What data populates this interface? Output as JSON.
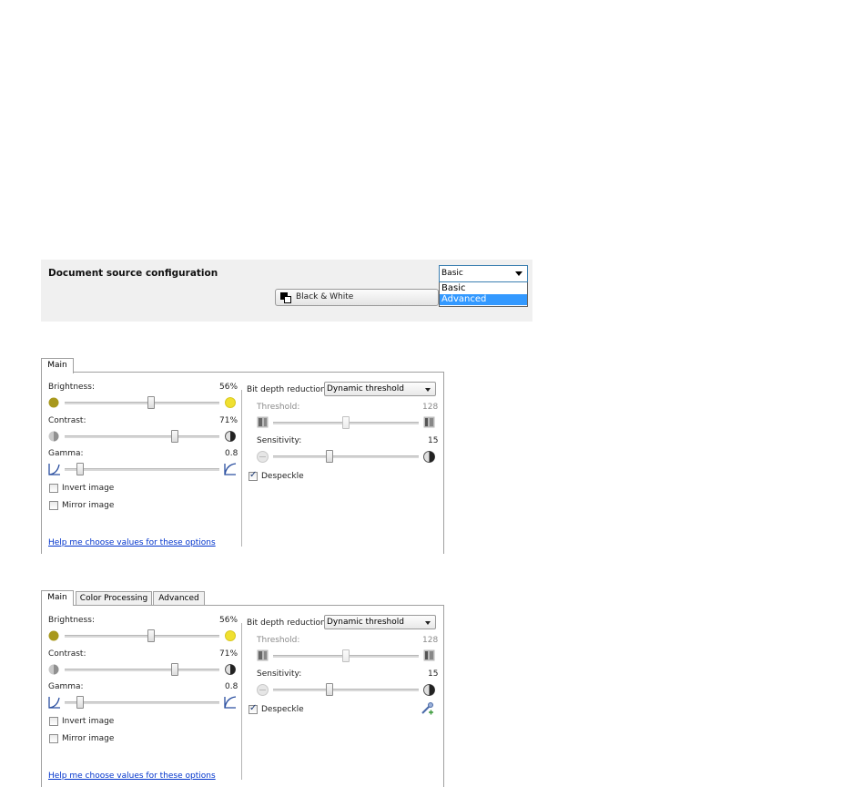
{
  "config": {
    "title": "Document source configuration",
    "color_mode": "Black & White",
    "profile_select": {
      "selected": "Basic",
      "options": [
        "Basic",
        "Advanced"
      ],
      "highlighted": "Advanced"
    }
  },
  "panels": [
    {
      "tabs": [
        "Main"
      ],
      "brightness": {
        "label": "Brightness:",
        "value": "56%",
        "level": 0.56
      },
      "contrast": {
        "label": "Contrast:",
        "value": "71%",
        "level": 0.71
      },
      "gamma": {
        "label": "Gamma:",
        "value": "0.8",
        "level": 0.1
      },
      "invert_label": "Invert image",
      "mirror_label": "Mirror image",
      "bit_depth_label": "Bit depth reduction:",
      "bit_depth_value": "Dynamic threshold",
      "threshold": {
        "label": "Threshold:",
        "value": "128",
        "level": 0.5
      },
      "sensitivity": {
        "label": "Sensitivity:",
        "value": "15",
        "level": 0.39
      },
      "despeckle_label": "Despeckle",
      "help_link": "Help me choose values for these options"
    },
    {
      "tabs": [
        "Main",
        "Color Processing",
        "Advanced"
      ],
      "brightness": {
        "label": "Brightness:",
        "value": "56%",
        "level": 0.56
      },
      "contrast": {
        "label": "Contrast:",
        "value": "71%",
        "level": 0.71
      },
      "gamma": {
        "label": "Gamma:",
        "value": "0.8",
        "level": 0.1
      },
      "invert_label": "Invert image",
      "mirror_label": "Mirror image",
      "bit_depth_label": "Bit depth reduction:",
      "bit_depth_value": "Dynamic threshold",
      "threshold": {
        "label": "Threshold:",
        "value": "128",
        "level": 0.5
      },
      "sensitivity": {
        "label": "Sensitivity:",
        "value": "15",
        "level": 0.39
      },
      "despeckle_label": "Despeckle",
      "help_link": "Help me choose values for these options"
    }
  ],
  "colors": {
    "panel_bg": "#f0f0f0",
    "selection": "#3399ff",
    "link": "#0033cc",
    "brightness_dark": "#a8981c",
    "brightness_light": "#f0e030"
  },
  "icons": {
    "color_mode": "black-white-icon",
    "brightness_low": "dim-circle-icon",
    "brightness_high": "bright-circle-icon",
    "contrast_low": "low-contrast-icon",
    "contrast_high": "high-contrast-icon",
    "gamma_low": "gamma-curve-low-icon",
    "gamma_high": "gamma-curve-high-icon",
    "threshold": "threshold-icon",
    "sensitivity_low": "low-sensitivity-icon",
    "sensitivity_high": "high-sensitivity-icon",
    "tool": "wand-tool-icon"
  }
}
